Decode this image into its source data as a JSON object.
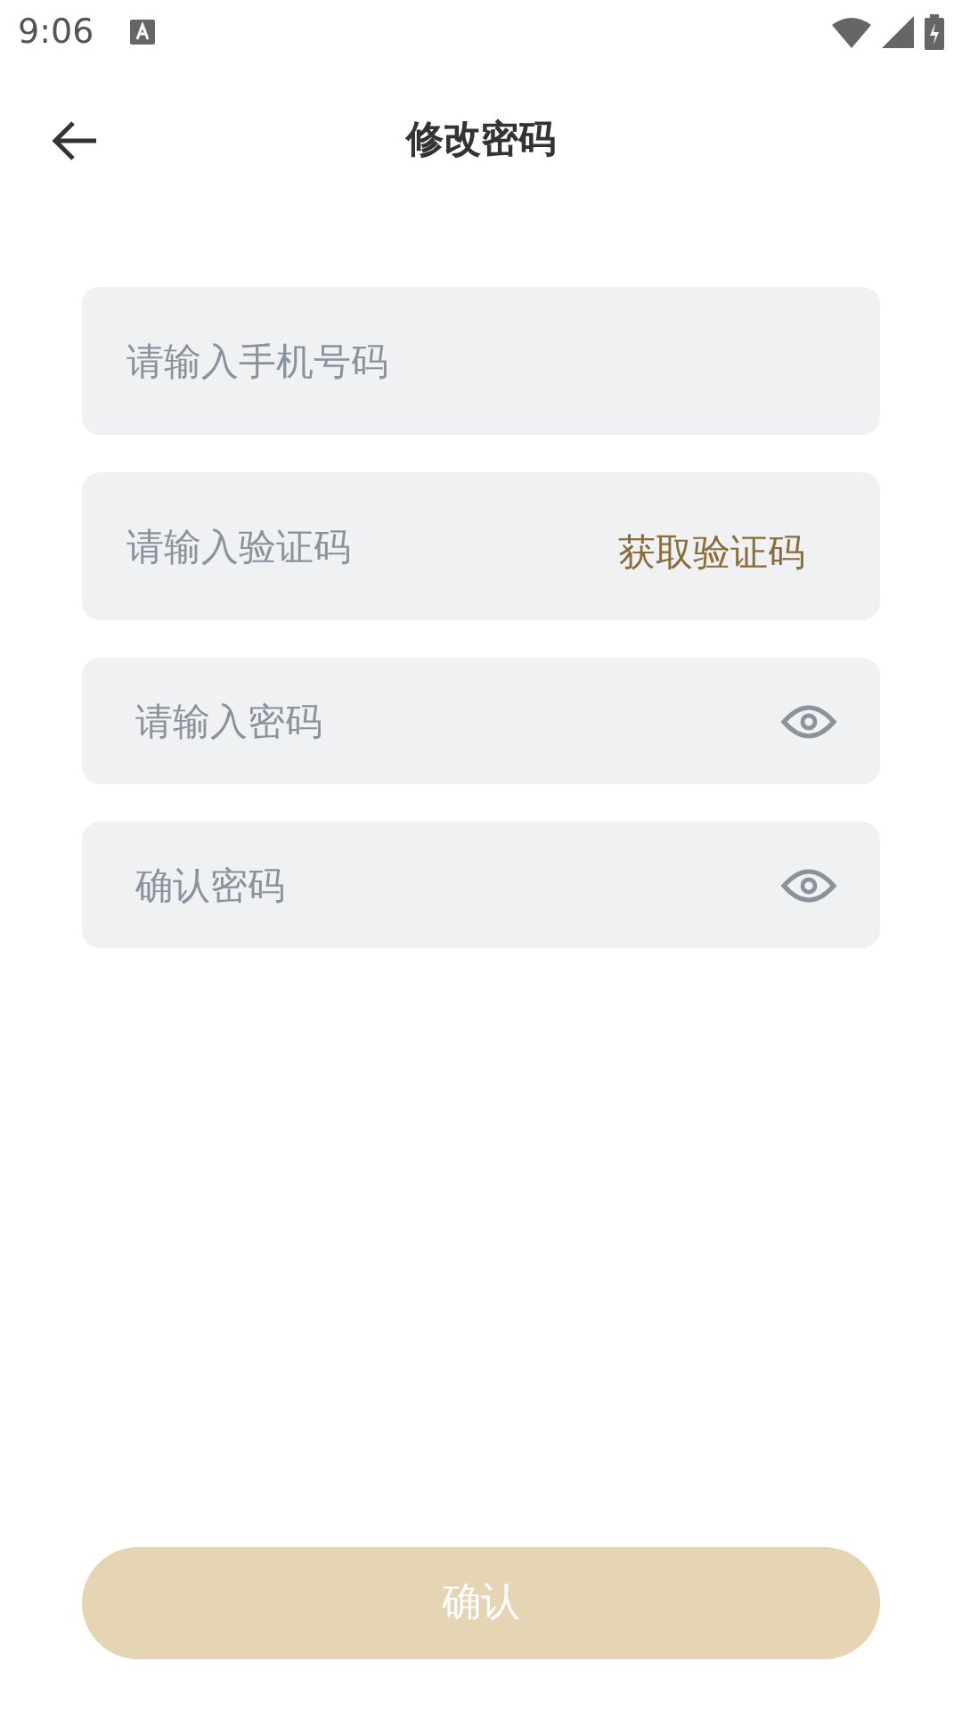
{
  "status_bar": {
    "time": "9:06"
  },
  "header": {
    "title": "修改密码"
  },
  "fields": [
    {
      "kind": "plain",
      "placeholder": "请输入手机号码"
    },
    {
      "kind": "code",
      "placeholder": "请输入验证码",
      "action": "获取验证码"
    },
    {
      "kind": "password",
      "placeholder": "请输入密码"
    },
    {
      "kind": "password",
      "placeholder": "确认密码"
    }
  ],
  "submit": {
    "label": "确认",
    "disabled": true
  }
}
